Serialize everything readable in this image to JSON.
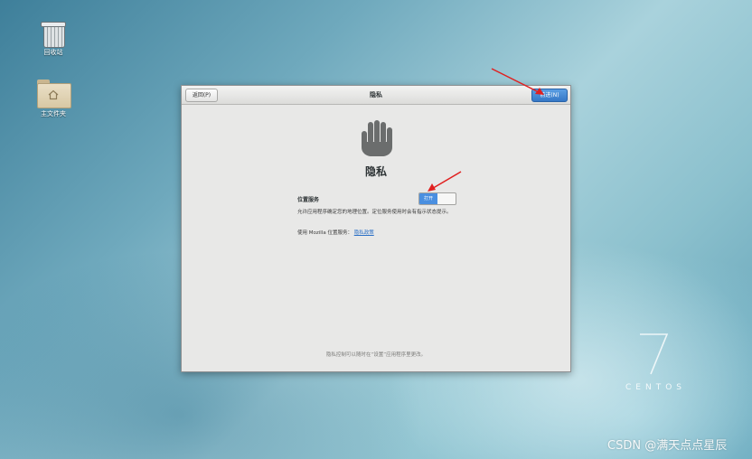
{
  "desktop": {
    "icons": [
      {
        "label": "回收站",
        "icon": "trash-icon"
      },
      {
        "label": "主文件夹",
        "icon": "home-folder-icon"
      }
    ]
  },
  "window": {
    "back_label": "返回(P)",
    "title": "隐私",
    "next_label": "前进(N)",
    "heading": "隐私",
    "location_service": {
      "label": "位置服务",
      "toggle_state": "打开",
      "description": "允许应用程序确定您的地理位置。定位服务使用时会有指示状态提示。",
      "policy_prefix": "使用 Mozilla 位置服务：",
      "policy_link": "隐私政策"
    },
    "footer_note": "隐私控制可以随时在“设置”应用程序里更改。"
  },
  "branding": {
    "centos_version": "7",
    "centos_name": "CENTOS"
  },
  "watermark": "CSDN @满天点点星辰",
  "colors": {
    "accent_blue": "#3a7fd5",
    "annotation_red": "#e02020"
  }
}
